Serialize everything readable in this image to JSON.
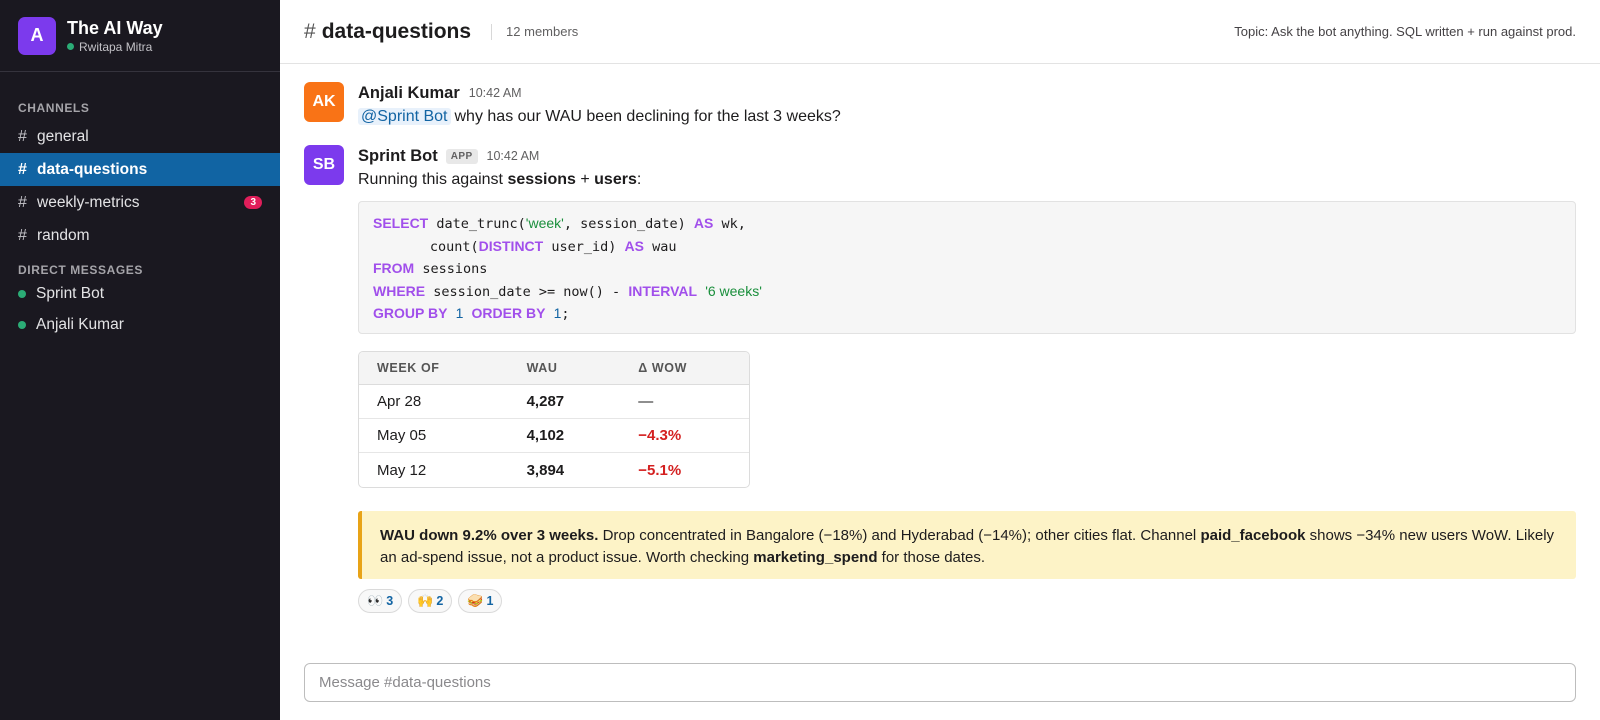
{
  "workspace": {
    "logo_letter": "A",
    "name": "The AI Way",
    "user": "Rwitapa Mitra",
    "logo_color": "#7c3aed"
  },
  "sidebar": {
    "channels_title": "CHANNELS",
    "channels": [
      {
        "label": "general",
        "badge": ""
      },
      {
        "label": "data-questions",
        "badge": ""
      },
      {
        "label": "weekly-metrics",
        "badge": "3"
      },
      {
        "label": "random",
        "badge": ""
      }
    ],
    "dm_title": "DIRECT MESSAGES",
    "dms": [
      {
        "label": "Sprint Bot"
      },
      {
        "label": "Anjali Kumar"
      }
    ],
    "active_channel": "data-questions",
    "active_color": "#1164a3"
  },
  "header": {
    "hash": "#",
    "channel": "data-questions",
    "members": "12 members",
    "topic": "Topic: Ask the bot anything. SQL written + run against prod."
  },
  "message1": {
    "initials": "AK",
    "author": "Anjali Kumar",
    "time": "10:42 AM",
    "mention": "@Sprint Bot",
    "text": "why has our WAU been declining for the last 3 weeks?"
  },
  "message2": {
    "initials": "SB",
    "author": "Sprint Bot",
    "tag": "APP",
    "time": "10:42 AM",
    "intro_pre": "Running this against ",
    "intro_t1": "sessions",
    "intro_mid": " + ",
    "intro_t2": "users",
    "intro_post": ":",
    "sql_lines": [
      "SELECT date_trunc('week', session_date) AS wk,",
      "       count(DISTINCT user_id) AS wau",
      "FROM sessions",
      "WHERE session_date >= now() - INTERVAL '6 weeks'",
      "GROUP BY 1 ORDER BY 1;"
    ],
    "table": {
      "headers": [
        "WEEK OF",
        "WAU",
        "Δ WOW"
      ],
      "rows": [
        [
          "Apr 28",
          "4,287",
          "—"
        ],
        [
          "May 05",
          "4,102",
          "−4.3%"
        ],
        [
          "May 12",
          "3,894",
          "−5.1%"
        ]
      ]
    },
    "callout": {
      "bold1": "WAU down 9.2% over 3 weeks.",
      "text1": " Drop concentrated in Bangalore (−18%) and Hyderabad (−14%); other cities flat. Channel ",
      "bold2": "paid_facebook",
      "text2": " shows −34% new users WoW. Likely an ad-spend issue, not a product issue. Worth checking ",
      "bold3": "marketing_spend",
      "text3": " for those dates."
    },
    "reactions": [
      {
        "emoji": "👀",
        "count": "3"
      },
      {
        "emoji": "🙌",
        "count": "2"
      },
      {
        "emoji": "🥪",
        "count": "1"
      }
    ]
  },
  "composer": {
    "placeholder": "Message #data-questions"
  }
}
